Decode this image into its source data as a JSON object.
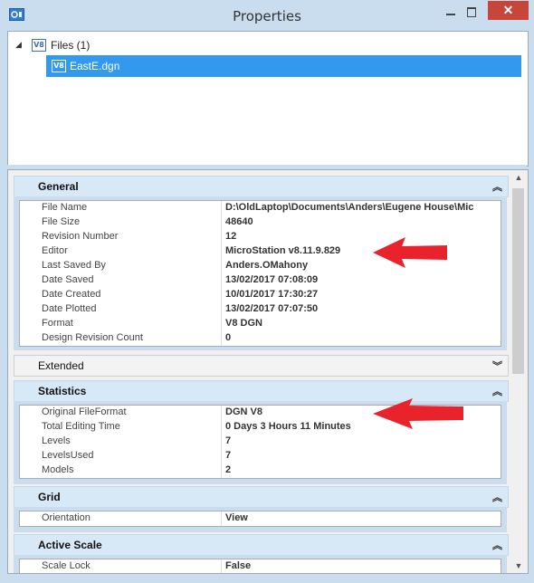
{
  "window": {
    "title": "Properties",
    "close_label": "✕"
  },
  "tree": {
    "root_label": "Files (1)",
    "root_icon_label": "V8",
    "child_label": "EastE.dgn",
    "child_icon_label": "V8"
  },
  "sections": {
    "general": {
      "title": "General",
      "rows": [
        {
          "label": "File Name",
          "value": "D:\\OldLaptop\\Documents\\Anders\\Eugene House\\Mic"
        },
        {
          "label": "File Size",
          "value": "48640"
        },
        {
          "label": "Revision Number",
          "value": "12"
        },
        {
          "label": "Editor",
          "value": "MicroStation v8.11.9.829"
        },
        {
          "label": "Last Saved By",
          "value": "Anders.OMahony"
        },
        {
          "label": "Date Saved",
          "value": "13/02/2017 07:08:09"
        },
        {
          "label": "Date Created",
          "value": "10/01/2017 17:30:27"
        },
        {
          "label": "Date Plotted",
          "value": "13/02/2017 07:07:50"
        },
        {
          "label": "Format",
          "value": "V8 DGN"
        },
        {
          "label": "Design Revision Count",
          "value": "0"
        }
      ]
    },
    "extended": {
      "title": "Extended"
    },
    "statistics": {
      "title": "Statistics",
      "rows": [
        {
          "label": "Original FileFormat",
          "value": "DGN V8"
        },
        {
          "label": "Total Editing Time",
          "value": "0 Days 3 Hours 11 Minutes"
        },
        {
          "label": "Levels",
          "value": "7"
        },
        {
          "label": "LevelsUsed",
          "value": "7"
        },
        {
          "label": "Models",
          "value": "2"
        }
      ]
    },
    "grid": {
      "title": "Grid",
      "rows": [
        {
          "label": "Orientation",
          "value": "View"
        }
      ]
    },
    "active_scale": {
      "title": "Active Scale",
      "rows": [
        {
          "label": "Scale Lock",
          "value": "False"
        }
      ]
    }
  },
  "colors": {
    "accent": "#3399ee",
    "annotation_arrow": "#e8232b",
    "close_button": "#c7453b"
  }
}
